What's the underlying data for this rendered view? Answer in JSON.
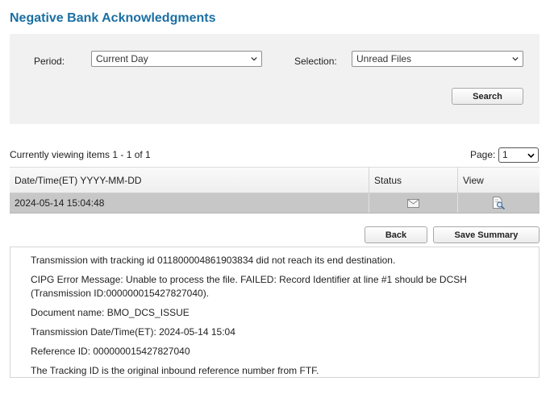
{
  "page": {
    "title": "Negative Bank Acknowledgments"
  },
  "filters": {
    "period_label": "Period:",
    "period_value": "Current Day",
    "selection_label": "Selection:",
    "selection_value": "Unread Files",
    "search_label": "Search"
  },
  "pager": {
    "viewing_text": "Currently viewing items 1 - 1 of 1",
    "page_label": "Page:",
    "page_value": "1"
  },
  "table": {
    "columns": [
      "Date/Time(ET) YYYY-MM-DD",
      "Status",
      "View"
    ],
    "rows": [
      {
        "datetime": "2024-05-14 15:04:48",
        "status_icon": "envelope-icon",
        "view_icon": "document-magnifier-icon"
      }
    ]
  },
  "actions": {
    "back_label": "Back",
    "save_summary_label": "Save Summary"
  },
  "details": {
    "line1": "Transmission with tracking id 011800004861903834 did not reach its end destination.",
    "line2a": "CIPG Error Message: Unable to process the file. FAILED: Record Identifier at line #1 should be DCSH",
    "line2b": "(Transmission ID:000000015427827040).",
    "line3": "Document name: BMO_DCS_ISSUE",
    "line4": "Transmission Date/Time(ET): 2024-05-14 15:04",
    "line5": "Reference ID: 000000015427827040",
    "line6": "The Tracking ID is the original inbound reference number from FTF."
  },
  "colors": {
    "title": "#1a6fa3",
    "panel_bg": "#f1f1f1",
    "selected_row": "#c7c7c7"
  }
}
